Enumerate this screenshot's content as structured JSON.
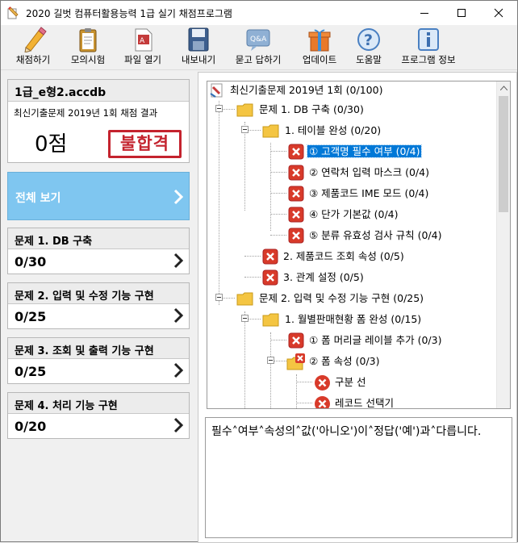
{
  "window": {
    "title": "2020 길벗 컴퓨터활용능력 1급 실기 채점프로그램"
  },
  "toolbar": {
    "grade": "채점하기",
    "mock_exam": "모의시험",
    "open_file": "파일 열기",
    "export": "내보내기",
    "qna": "묻고 답하기",
    "update": "업데이트",
    "help": "도움말",
    "program_info": "프로그램 정보",
    "qna_icon_text": "Q&A"
  },
  "result": {
    "file_name": "1급_e형2.accdb",
    "title": "최신기출문제 2019년 1회 채점 결과",
    "score": "0점",
    "verdict": "불합격"
  },
  "view_all": {
    "label": "전체 보기"
  },
  "sections": [
    {
      "title": "문제 1. DB 구축",
      "score": "0/30"
    },
    {
      "title": "문제 2. 입력 및 수정 기능 구현",
      "score": "0/25"
    },
    {
      "title": "문제 3. 조회 및 출력 기능 구현",
      "score": "0/25"
    },
    {
      "title": "문제 4. 처리 기능 구현",
      "score": "0/20"
    }
  ],
  "tree": {
    "root": "최신기출문제 2019년 1회 (0/100)",
    "n1": "문제 1. DB 구축 (0/30)",
    "n1_1": "1. 테이블 완성 (0/20)",
    "n1_1_1": "① 고객명 필수 여부 (0/4)",
    "n1_1_2": "② 연락처 입력 마스크 (0/4)",
    "n1_1_3": "③ 제품코드 IME 모드 (0/4)",
    "n1_1_4": "④ 단가 기본값 (0/4)",
    "n1_1_5": "⑤ 분류 유효성 검사 규칙 (0/4)",
    "n1_2": "2. 제품코드 조회 속성 (0/5)",
    "n1_3": "3. 관계 설정 (0/5)",
    "n2": "문제 2. 입력 및 수정 기능 구현 (0/25)",
    "n2_1": "1. 월별판매현황 폼 완성 (0/15)",
    "n2_1_1": "① 폼 머리글 레이블 추가 (0/3)",
    "n2_1_2": "② 폼 속성 (0/3)",
    "n2_1_2_a": "구분 선",
    "n2_1_2_b": "레코드 선택기"
  },
  "description": "필수˄여부˄속성의˄값('아니오')이˄정답('예')과˄다릅니다."
}
